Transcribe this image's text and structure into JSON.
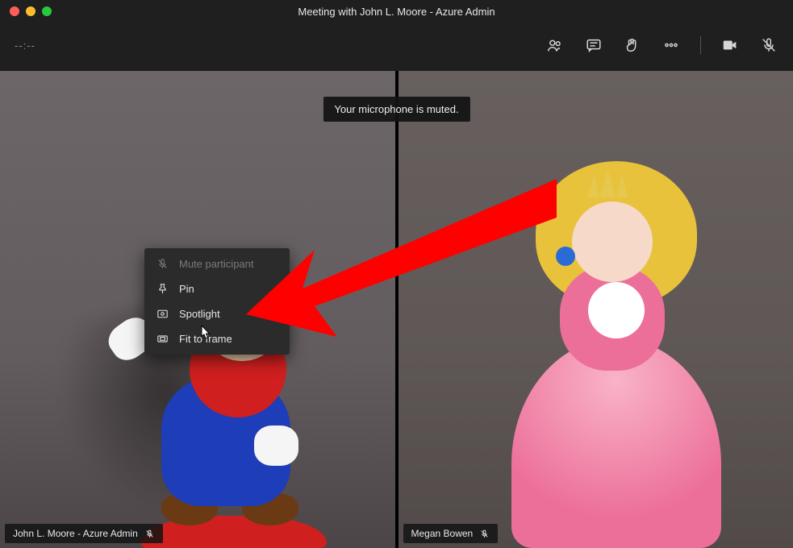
{
  "title": "Meeting with John L. Moore - Azure Admin",
  "window_controls": {
    "close": "close",
    "minimize": "minimize",
    "maximize": "maximize"
  },
  "toolbar": {
    "timer": "--:--",
    "icons": {
      "people": "people-icon",
      "chat": "chat-icon",
      "raise_hand": "raise-hand-icon",
      "more": "more-icon",
      "camera": "camera-icon",
      "mic": "mic-muted-icon"
    }
  },
  "toast": {
    "message": "Your microphone is muted."
  },
  "participants": [
    {
      "name": "John L. Moore - Azure Admin",
      "muted": true
    },
    {
      "name": "Megan Bowen",
      "muted": true
    }
  ],
  "context_menu": {
    "items": [
      {
        "label": "Mute participant",
        "icon": "mic-off-icon",
        "enabled": false
      },
      {
        "label": "Pin",
        "icon": "pin-icon",
        "enabled": true
      },
      {
        "label": "Spotlight",
        "icon": "spotlight-icon",
        "enabled": true
      },
      {
        "label": "Fit to frame",
        "icon": "fit-frame-icon",
        "enabled": true
      }
    ]
  },
  "annotation": {
    "kind": "arrow",
    "color": "#ff0000",
    "target": "context-menu-item-spotlight"
  }
}
